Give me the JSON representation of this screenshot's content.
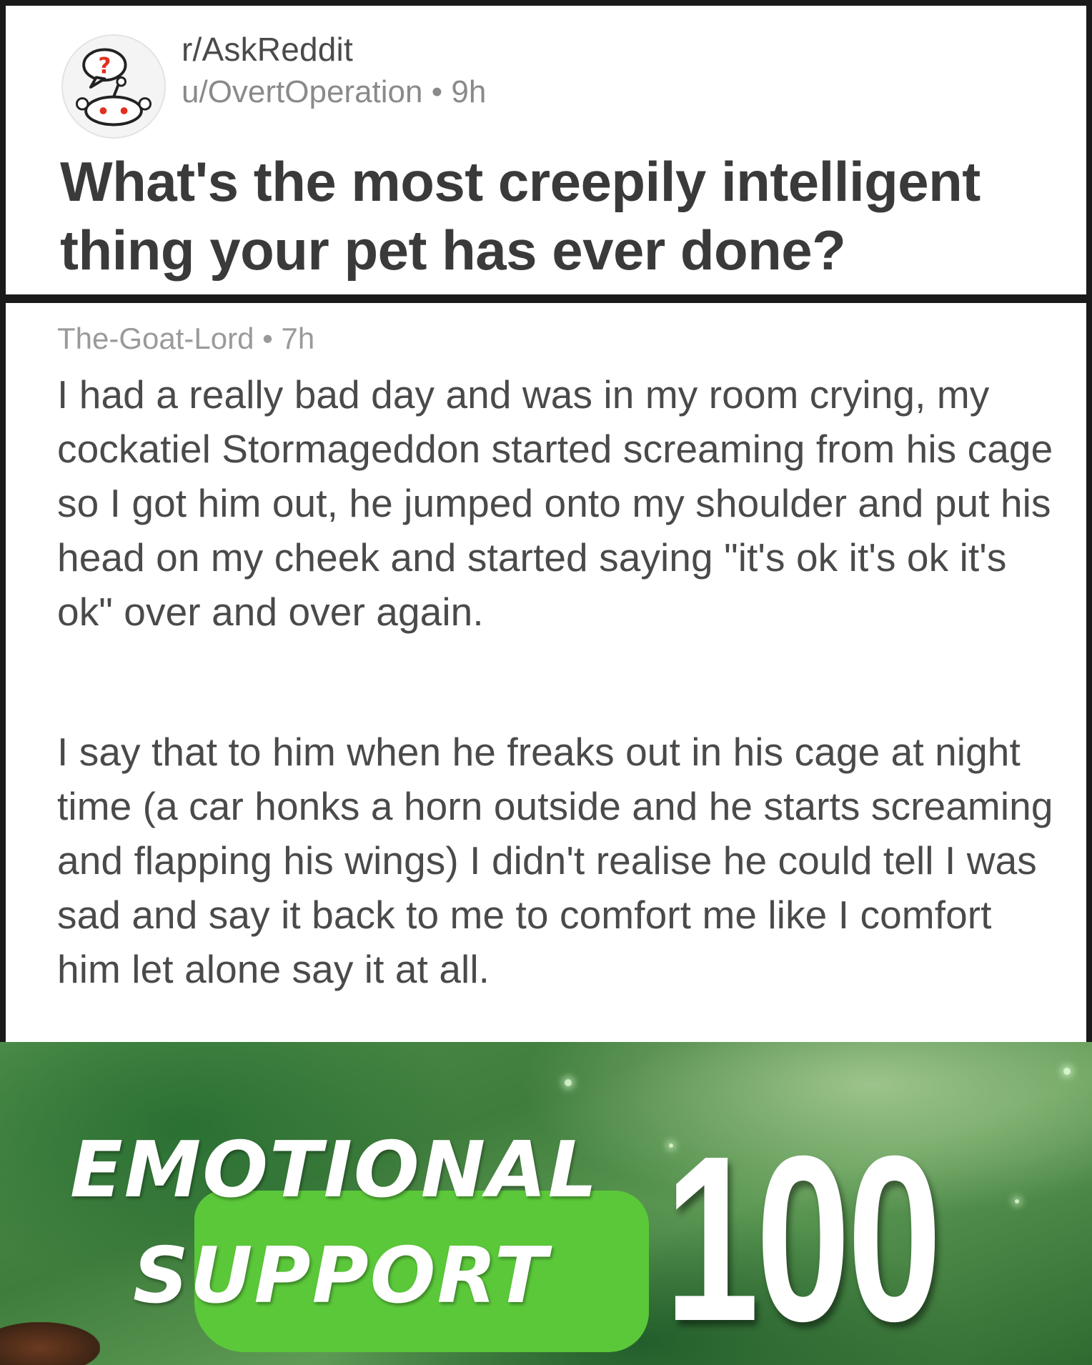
{
  "post": {
    "subreddit": "r/AskReddit",
    "author": "u/OvertOperation",
    "separator": "•",
    "age": "9h",
    "title": "What's the most creepily intelligent thing your pet has ever done?",
    "avatar_icon": "askreddit-snoo-icon"
  },
  "comment": {
    "author": "The-Goat-Lord",
    "separator": "•",
    "age": "7h",
    "paragraphs": [
      "I had a really bad day and was in my room crying, my cockatiel Stormageddon started screaming from his cage so I got him out, he jumped onto my shoulder and put his head on my cheek and started saying \"it's ok it's ok it's ok\" over and over again.",
      "I say that to him when he freaks out in his cage at night time (a car honks a horn outside and he starts screaming and flapping his wings) I didn't realise he could tell I was sad and say it back to me to comfort me like I comfort him let alone say it at all."
    ]
  },
  "banner": {
    "skill_line_1": "EMOTIONAL",
    "skill_line_2": "SUPPORT",
    "level": "100",
    "highlight_color": "#5bc83a",
    "background_color": "#3f7d3c"
  }
}
